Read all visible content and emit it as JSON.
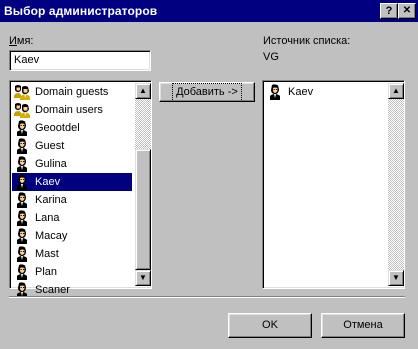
{
  "window": {
    "title": "Выбор администраторов",
    "help_label": "?",
    "close_label": "✕"
  },
  "name_field": {
    "label_accel": "И",
    "label_rest": "мя:",
    "value": "Kaev"
  },
  "source": {
    "label": "Источник списка:",
    "value": "VG"
  },
  "users_list": {
    "items": [
      {
        "label": "Domain guests",
        "icon": "user-group-icon",
        "selected": false
      },
      {
        "label": "Domain users",
        "icon": "user-group-icon",
        "selected": false
      },
      {
        "label": "Geootdel",
        "icon": "user-icon",
        "selected": false
      },
      {
        "label": "Guest",
        "icon": "user-icon",
        "selected": false
      },
      {
        "label": "Gulina",
        "icon": "user-icon",
        "selected": false
      },
      {
        "label": "Kaev",
        "icon": "user-icon",
        "selected": true
      },
      {
        "label": "Karina",
        "icon": "user-icon",
        "selected": false
      },
      {
        "label": "Lana",
        "icon": "user-icon",
        "selected": false
      },
      {
        "label": "Macay",
        "icon": "user-icon",
        "selected": false
      },
      {
        "label": "Mast",
        "icon": "user-icon",
        "selected": false
      },
      {
        "label": "Plan",
        "icon": "user-icon",
        "selected": false
      },
      {
        "label": "Scaner",
        "icon": "user-icon",
        "selected": false
      }
    ]
  },
  "add_button": {
    "accel": "Д",
    "rest": "обавить ->"
  },
  "selected_list": {
    "items": [
      {
        "label": "Kaev",
        "icon": "user-icon"
      }
    ]
  },
  "buttons": {
    "ok": "OK",
    "cancel": "Отмена"
  },
  "colors": {
    "title_bar": "#000080",
    "face": "#c0c0c0",
    "selection": "#000080"
  }
}
